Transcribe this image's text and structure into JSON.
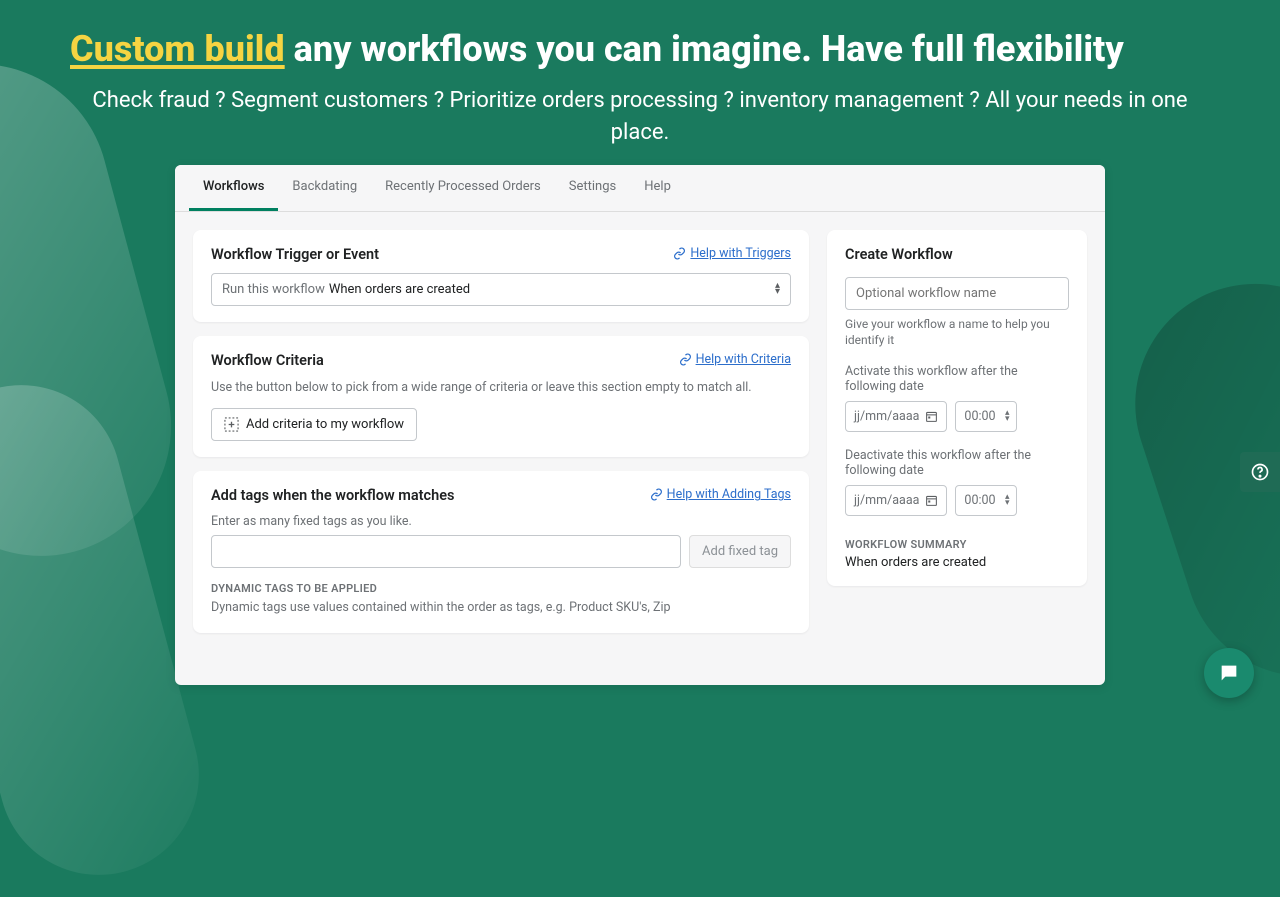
{
  "hero": {
    "highlight": "Custom build",
    "rest": " any workflows you can imagine. Have full flexibility",
    "sub": "Check fraud ? Segment customers ?  Prioritize orders processing ? inventory management ? All your needs in one place."
  },
  "tabs": [
    {
      "label": "Workflows",
      "active": true
    },
    {
      "label": "Backdating",
      "active": false
    },
    {
      "label": "Recently Processed Orders",
      "active": false
    },
    {
      "label": "Settings",
      "active": false
    },
    {
      "label": "Help",
      "active": false
    }
  ],
  "trigger": {
    "title": "Workflow Trigger or Event",
    "help": "Help with Triggers",
    "select_prefix": "Run this workflow",
    "select_value": "When orders are created"
  },
  "criteria": {
    "title": "Workflow Criteria",
    "help": "Help with Criteria",
    "desc": "Use the button below to pick from a wide range of criteria or leave this section empty to match all.",
    "button": "Add criteria to my workflow"
  },
  "tags": {
    "title": "Add tags when the workflow matches",
    "help": "Help with Adding Tags",
    "label": "Enter as many fixed tags as you like.",
    "add_button": "Add fixed tag",
    "dynamic_heading": "DYNAMIC TAGS TO BE APPLIED",
    "dynamic_desc": "Dynamic tags use values contained within the order as tags, e.g. Product SKU's, Zip"
  },
  "create": {
    "title": "Create Workflow",
    "name_placeholder": "Optional workflow name",
    "name_help": "Give your workflow a name to help you identify it",
    "activate_label": "Activate this workflow after the following date",
    "deactivate_label": "Deactivate this workflow after the following date",
    "date_placeholder": "jj/mm/aaaa",
    "time_placeholder": "00:00",
    "summary_heading": "WORKFLOW SUMMARY",
    "summary_text": "When orders are created"
  }
}
